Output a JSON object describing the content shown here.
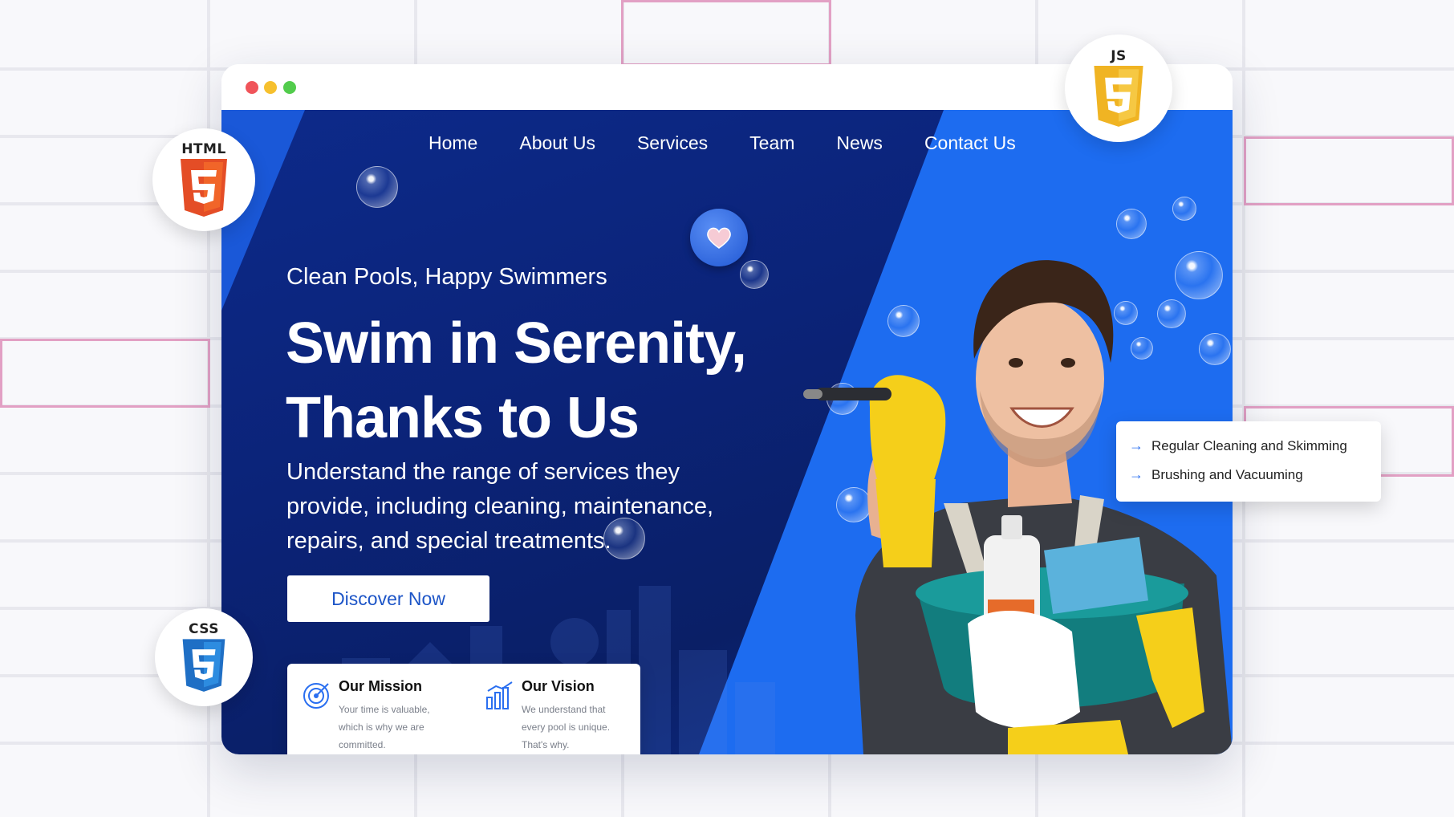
{
  "nav": {
    "items": [
      "Home",
      "About Us",
      "Services",
      "Team",
      "News",
      "Contact Us"
    ]
  },
  "hero": {
    "eyebrow": "Clean Pools, Happy Swimmers",
    "headline_line1": "Swim in Serenity,",
    "headline_line2": "Thanks to Us",
    "subtext": "Understand the range of services they provide, including cleaning, maintenance, repairs, and special treatments.",
    "cta_label": "Discover Now"
  },
  "mission": {
    "title": "Our Mission",
    "text": "Your time is valuable, which is why we are committed."
  },
  "vision": {
    "title": "Our Vision",
    "text": "We understand that every pool is unique. That's why."
  },
  "features": [
    "Regular Cleaning and Skimming",
    "Brushing and Vacuuming"
  ],
  "badges": {
    "html": "HTML",
    "css": "CSS",
    "js": "JS"
  },
  "colors": {
    "hero_dark": "#0b2378",
    "hero_light": "#1d6cf0",
    "accent": "#2a6ff0",
    "html_orange": "#e44d26",
    "css_blue": "#1f6fc5",
    "js_yellow": "#f0b423"
  }
}
